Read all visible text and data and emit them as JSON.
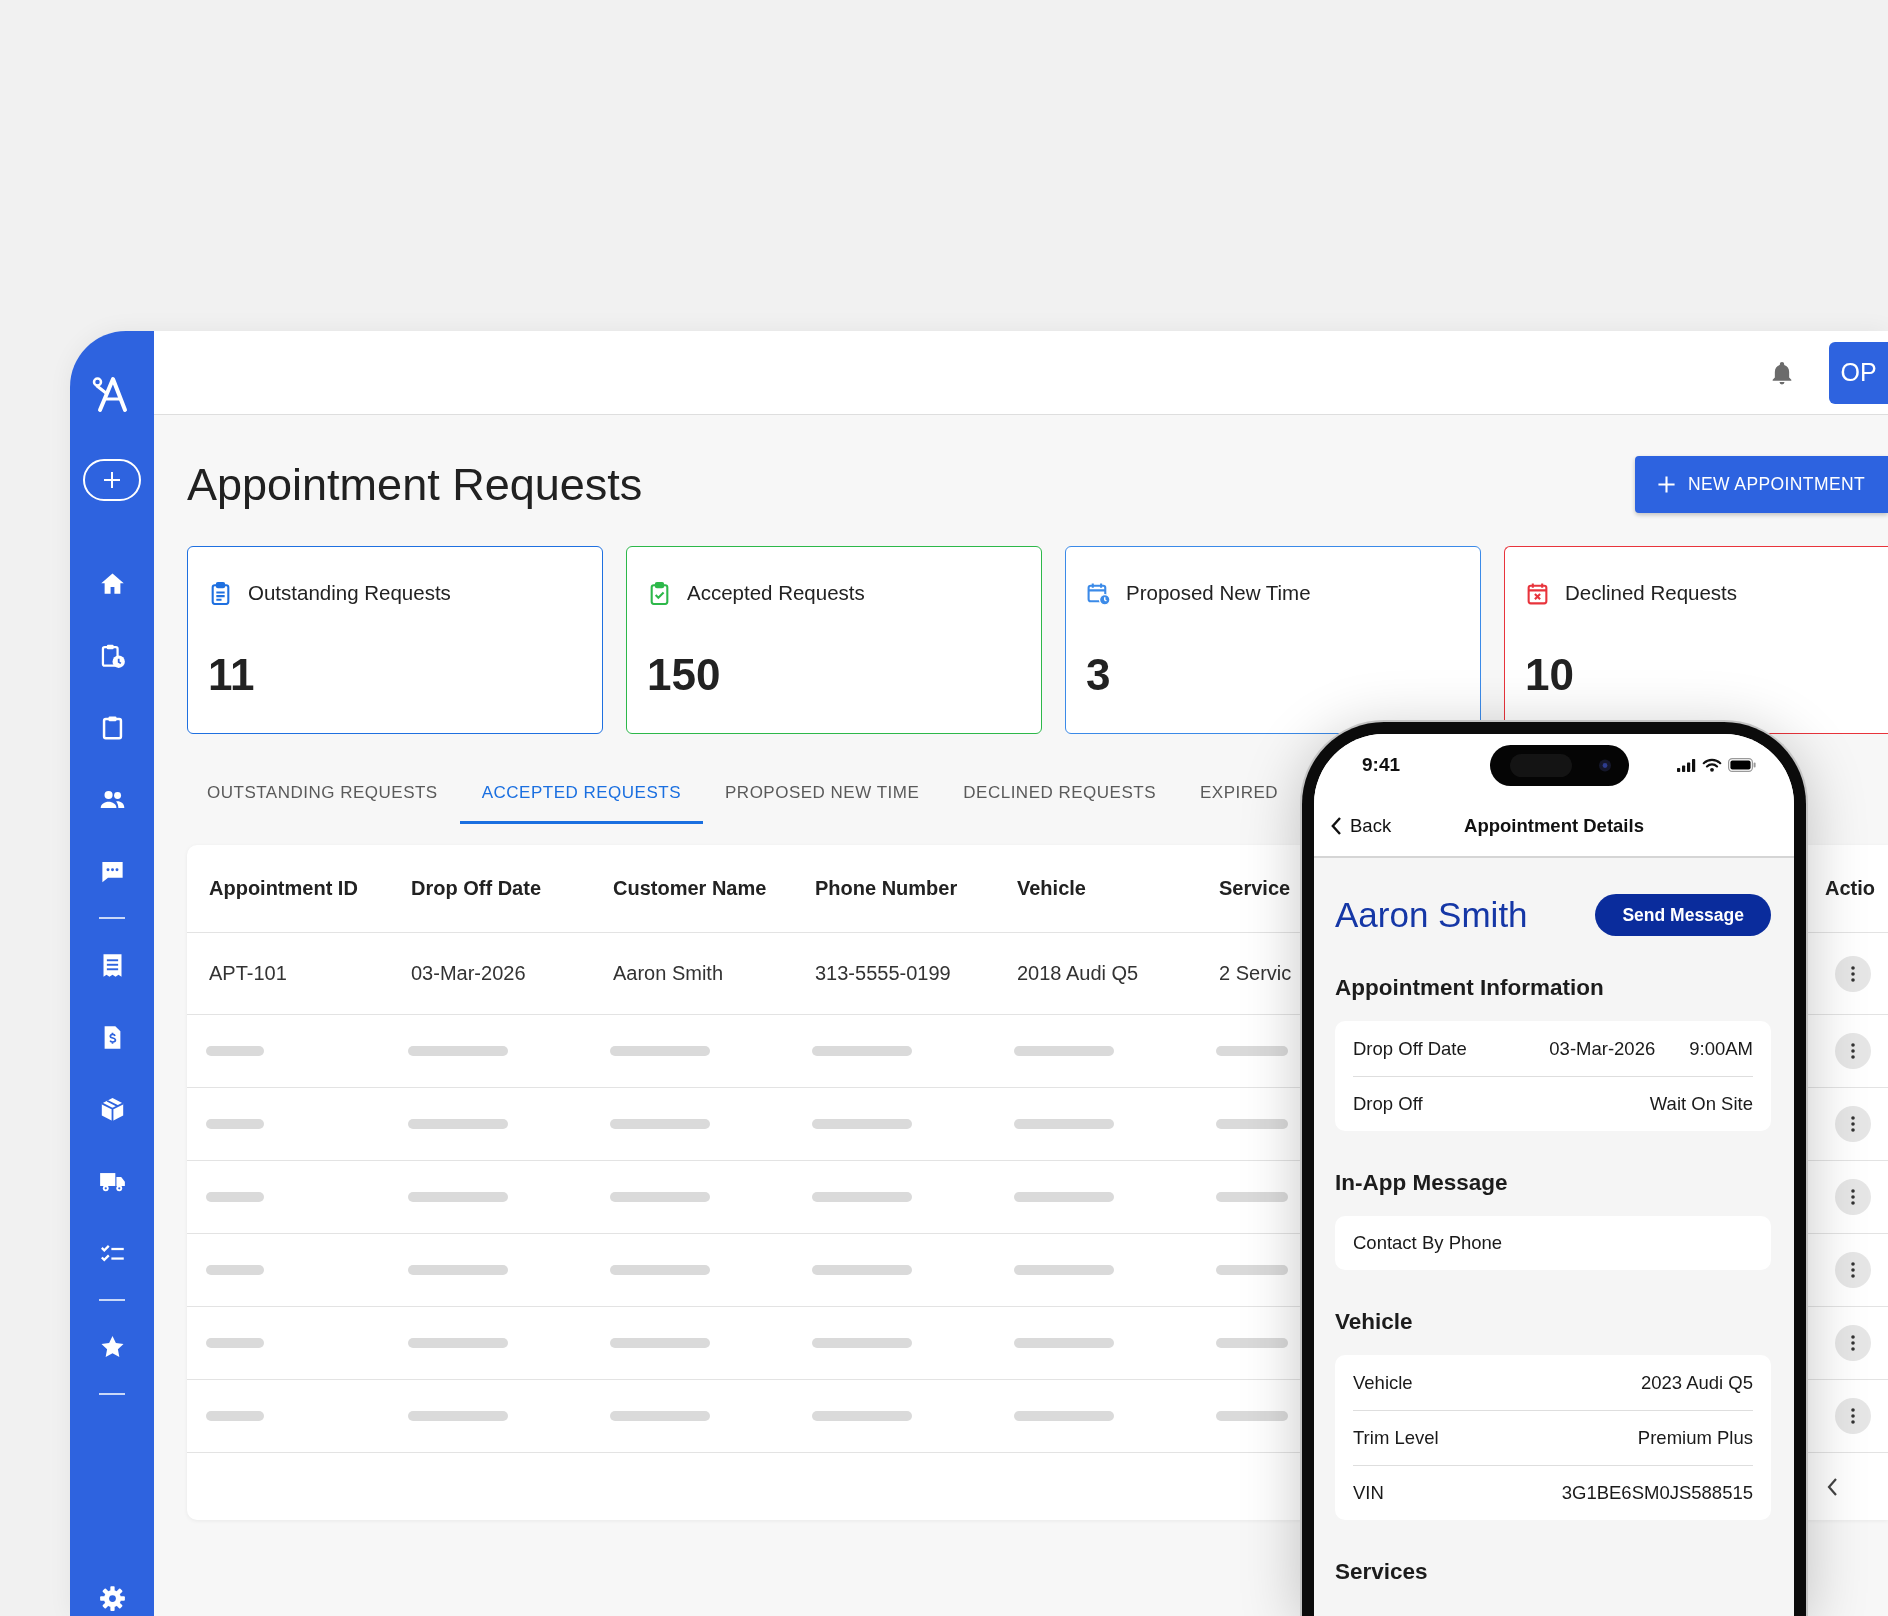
{
  "top_bar": {
    "avatar": "OP"
  },
  "header": {
    "title": "Appointment Requests",
    "new_button": "NEW APPOINTMENT"
  },
  "summary_cards": [
    {
      "kind": "outstanding",
      "label": "Outstanding Requests",
      "count": "11",
      "color": "#1f70e0"
    },
    {
      "kind": "accepted",
      "label": "Accepted Requests",
      "count": "150",
      "color": "#2db84a"
    },
    {
      "kind": "proposed",
      "label": "Proposed New Time",
      "count": "3",
      "color": "#3b8ae8"
    },
    {
      "kind": "declined",
      "label": "Declined Requests",
      "count": "10",
      "color": "#e8343c"
    }
  ],
  "tabs": [
    {
      "label": "OUTSTANDING REQUESTS",
      "selected": false
    },
    {
      "label": "ACCEPTED REQUESTS",
      "selected": true
    },
    {
      "label": "PROPOSED NEW TIME",
      "selected": false
    },
    {
      "label": "DECLINED REQUESTS",
      "selected": false
    },
    {
      "label": "EXPIRED",
      "selected": false
    }
  ],
  "table": {
    "columns": [
      {
        "label": "Appointment ID",
        "kind": "text"
      },
      {
        "label": "Drop Off Date",
        "kind": "text"
      },
      {
        "label": "Customer Name",
        "kind": "text"
      },
      {
        "label": "Phone Number",
        "kind": "text"
      },
      {
        "label": "Vehicle",
        "kind": "text"
      },
      {
        "label": "Service",
        "kind": "text"
      },
      {
        "label": "Actio",
        "kind": "actions"
      }
    ],
    "rows": [
      {
        "kind": "data",
        "cells": [
          "APT-101",
          "03-Mar-2026",
          "Aaron Smith",
          "313-5555-0199",
          "2018 Audi Q5",
          "2 Servic"
        ]
      },
      {
        "kind": "skeleton"
      },
      {
        "kind": "skeleton"
      },
      {
        "kind": "skeleton"
      },
      {
        "kind": "skeleton"
      },
      {
        "kind": "skeleton"
      },
      {
        "kind": "skeleton"
      }
    ]
  },
  "phone": {
    "time": "9:41",
    "back": "Back",
    "title": "Appointment Details",
    "customer": "Aaron Smith",
    "action": "Send Message",
    "sections": [
      {
        "kind": "details",
        "heading": "Appointment Information",
        "rows": [
          {
            "label": "Drop Off Date",
            "values": [
              "03-Mar-2026",
              "9:00AM"
            ]
          },
          {
            "label": "Drop Off",
            "values": [
              "Wait On Site"
            ]
          }
        ]
      },
      {
        "kind": "note",
        "heading": "In-App Message",
        "text": "Contact By Phone"
      },
      {
        "kind": "details",
        "heading": "Vehicle",
        "rows": [
          {
            "label": "Vehicle",
            "values": [
              "2023 Audi Q5"
            ]
          },
          {
            "label": "Trim Level",
            "values": [
              "Premium Plus"
            ]
          },
          {
            "label": "VIN",
            "values": [
              "3G1BE6SM0JS588515"
            ]
          }
        ]
      },
      {
        "kind": "details",
        "heading": "Services"
      }
    ]
  }
}
